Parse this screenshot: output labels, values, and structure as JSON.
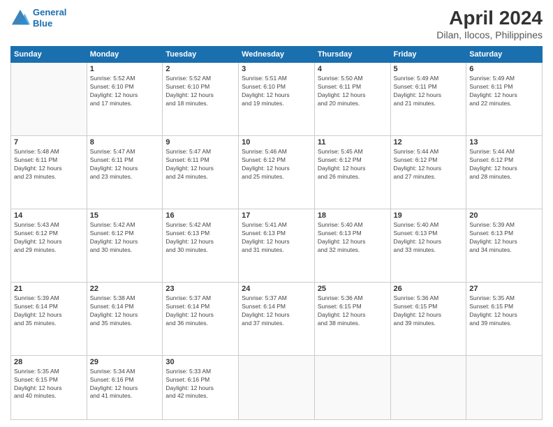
{
  "header": {
    "logo_line1": "General",
    "logo_line2": "Blue",
    "title": "April 2024",
    "subtitle": "Dilan, Ilocos, Philippines"
  },
  "days_of_week": [
    "Sunday",
    "Monday",
    "Tuesday",
    "Wednesday",
    "Thursday",
    "Friday",
    "Saturday"
  ],
  "weeks": [
    [
      {
        "day": "",
        "info": ""
      },
      {
        "day": "1",
        "info": "Sunrise: 5:52 AM\nSunset: 6:10 PM\nDaylight: 12 hours\nand 17 minutes."
      },
      {
        "day": "2",
        "info": "Sunrise: 5:52 AM\nSunset: 6:10 PM\nDaylight: 12 hours\nand 18 minutes."
      },
      {
        "day": "3",
        "info": "Sunrise: 5:51 AM\nSunset: 6:10 PM\nDaylight: 12 hours\nand 19 minutes."
      },
      {
        "day": "4",
        "info": "Sunrise: 5:50 AM\nSunset: 6:11 PM\nDaylight: 12 hours\nand 20 minutes."
      },
      {
        "day": "5",
        "info": "Sunrise: 5:49 AM\nSunset: 6:11 PM\nDaylight: 12 hours\nand 21 minutes."
      },
      {
        "day": "6",
        "info": "Sunrise: 5:49 AM\nSunset: 6:11 PM\nDaylight: 12 hours\nand 22 minutes."
      }
    ],
    [
      {
        "day": "7",
        "info": "Sunrise: 5:48 AM\nSunset: 6:11 PM\nDaylight: 12 hours\nand 23 minutes."
      },
      {
        "day": "8",
        "info": "Sunrise: 5:47 AM\nSunset: 6:11 PM\nDaylight: 12 hours\nand 23 minutes."
      },
      {
        "day": "9",
        "info": "Sunrise: 5:47 AM\nSunset: 6:11 PM\nDaylight: 12 hours\nand 24 minutes."
      },
      {
        "day": "10",
        "info": "Sunrise: 5:46 AM\nSunset: 6:12 PM\nDaylight: 12 hours\nand 25 minutes."
      },
      {
        "day": "11",
        "info": "Sunrise: 5:45 AM\nSunset: 6:12 PM\nDaylight: 12 hours\nand 26 minutes."
      },
      {
        "day": "12",
        "info": "Sunrise: 5:44 AM\nSunset: 6:12 PM\nDaylight: 12 hours\nand 27 minutes."
      },
      {
        "day": "13",
        "info": "Sunrise: 5:44 AM\nSunset: 6:12 PM\nDaylight: 12 hours\nand 28 minutes."
      }
    ],
    [
      {
        "day": "14",
        "info": "Sunrise: 5:43 AM\nSunset: 6:12 PM\nDaylight: 12 hours\nand 29 minutes."
      },
      {
        "day": "15",
        "info": "Sunrise: 5:42 AM\nSunset: 6:12 PM\nDaylight: 12 hours\nand 30 minutes."
      },
      {
        "day": "16",
        "info": "Sunrise: 5:42 AM\nSunset: 6:13 PM\nDaylight: 12 hours\nand 30 minutes."
      },
      {
        "day": "17",
        "info": "Sunrise: 5:41 AM\nSunset: 6:13 PM\nDaylight: 12 hours\nand 31 minutes."
      },
      {
        "day": "18",
        "info": "Sunrise: 5:40 AM\nSunset: 6:13 PM\nDaylight: 12 hours\nand 32 minutes."
      },
      {
        "day": "19",
        "info": "Sunrise: 5:40 AM\nSunset: 6:13 PM\nDaylight: 12 hours\nand 33 minutes."
      },
      {
        "day": "20",
        "info": "Sunrise: 5:39 AM\nSunset: 6:13 PM\nDaylight: 12 hours\nand 34 minutes."
      }
    ],
    [
      {
        "day": "21",
        "info": "Sunrise: 5:39 AM\nSunset: 6:14 PM\nDaylight: 12 hours\nand 35 minutes."
      },
      {
        "day": "22",
        "info": "Sunrise: 5:38 AM\nSunset: 6:14 PM\nDaylight: 12 hours\nand 35 minutes."
      },
      {
        "day": "23",
        "info": "Sunrise: 5:37 AM\nSunset: 6:14 PM\nDaylight: 12 hours\nand 36 minutes."
      },
      {
        "day": "24",
        "info": "Sunrise: 5:37 AM\nSunset: 6:14 PM\nDaylight: 12 hours\nand 37 minutes."
      },
      {
        "day": "25",
        "info": "Sunrise: 5:36 AM\nSunset: 6:15 PM\nDaylight: 12 hours\nand 38 minutes."
      },
      {
        "day": "26",
        "info": "Sunrise: 5:36 AM\nSunset: 6:15 PM\nDaylight: 12 hours\nand 39 minutes."
      },
      {
        "day": "27",
        "info": "Sunrise: 5:35 AM\nSunset: 6:15 PM\nDaylight: 12 hours\nand 39 minutes."
      }
    ],
    [
      {
        "day": "28",
        "info": "Sunrise: 5:35 AM\nSunset: 6:15 PM\nDaylight: 12 hours\nand 40 minutes."
      },
      {
        "day": "29",
        "info": "Sunrise: 5:34 AM\nSunset: 6:16 PM\nDaylight: 12 hours\nand 41 minutes."
      },
      {
        "day": "30",
        "info": "Sunrise: 5:33 AM\nSunset: 6:16 PM\nDaylight: 12 hours\nand 42 minutes."
      },
      {
        "day": "",
        "info": ""
      },
      {
        "day": "",
        "info": ""
      },
      {
        "day": "",
        "info": ""
      },
      {
        "day": "",
        "info": ""
      }
    ]
  ]
}
